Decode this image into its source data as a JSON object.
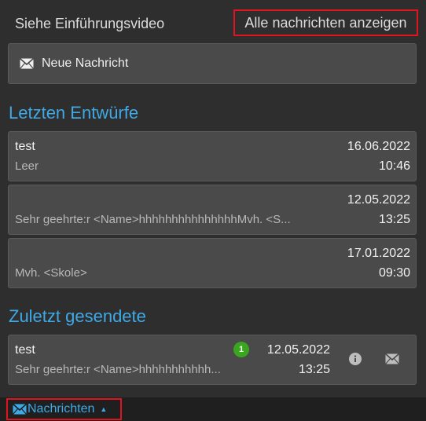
{
  "header": {
    "intro_video_link": "Siehe Einführungsvideo",
    "show_all_link": "Alle nachrichten anzeigen"
  },
  "new_message": {
    "label": "Neue Nachricht",
    "icon": "envelope-icon"
  },
  "drafts": {
    "title": "Letzten Entwürfe",
    "items": [
      {
        "subject": "test",
        "preview": "Leer",
        "date": "16.06.2022",
        "time": "10:46"
      },
      {
        "subject": "",
        "preview": "Sehr geehrte:r  <Name>hhhhhhhhhhhhhhhMvh. <S...",
        "date": "12.05.2022",
        "time": "13:25"
      },
      {
        "subject": "",
        "preview": "Mvh. <Skole>",
        "date": "17.01.2022",
        "time": "09:30"
      }
    ]
  },
  "sent": {
    "title": "Zuletzt gesendete",
    "items": [
      {
        "subject": "test",
        "preview": "Sehr geehrte:r  <Name>hhhhhhhhhhh...",
        "badge": "1",
        "date": "12.05.2022",
        "time": "13:25",
        "info_icon": "info-icon",
        "mail_icon": "envelope-icon"
      }
    ]
  },
  "bottom_nav": {
    "label": "Nachrichten",
    "icon": "envelope-icon",
    "caret": "▲"
  },
  "colors": {
    "accent": "#3fa9e6",
    "highlight_border": "#e0141e",
    "badge": "#3aa51f"
  }
}
